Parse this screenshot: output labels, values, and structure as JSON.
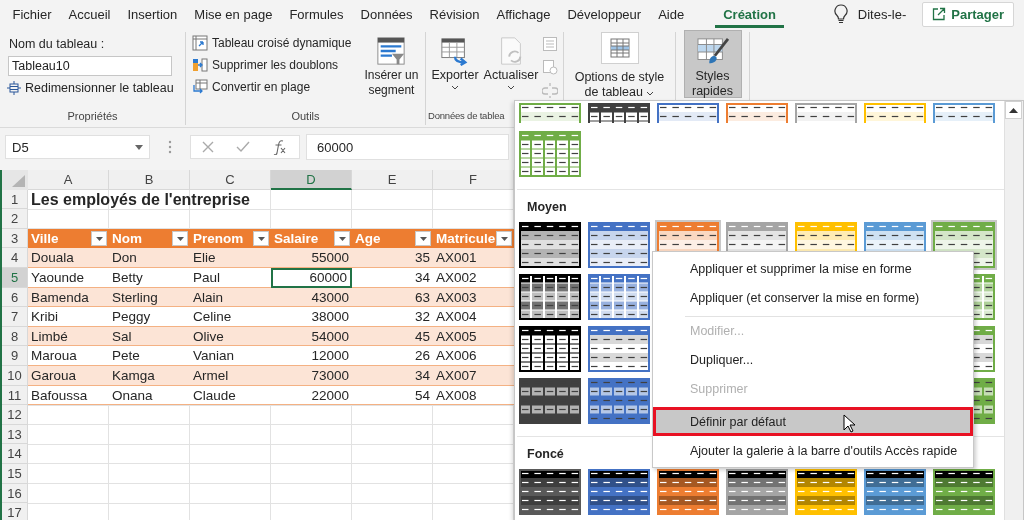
{
  "menu_tabs": [
    {
      "label": "Fichier",
      "selected": false
    },
    {
      "label": "Accueil",
      "selected": false
    },
    {
      "label": "Insertion",
      "selected": false
    },
    {
      "label": "Mise en page",
      "selected": false
    },
    {
      "label": "Formules",
      "selected": false
    },
    {
      "label": "Données",
      "selected": false
    },
    {
      "label": "Révision",
      "selected": false
    },
    {
      "label": "Affichage",
      "selected": false
    },
    {
      "label": "Développeur",
      "selected": false
    },
    {
      "label": "Aide",
      "selected": false
    },
    {
      "label": "Création",
      "selected": true
    }
  ],
  "tell_me": "Dites-le-",
  "share_button": "Partager",
  "properties_group": {
    "label": "Propriétés",
    "name_label": "Nom du tableau :",
    "name_value": "Tableau10",
    "resize_button": "Redimensionner le tableau"
  },
  "tools_group": {
    "label": "Outils",
    "commands": [
      {
        "kind": "pivot",
        "label": "Tableau croisé dynamique"
      },
      {
        "kind": "dedupe",
        "label": "Supprimer les doublons"
      },
      {
        "kind": "convert",
        "label": "Convertir en plage"
      }
    ],
    "slicer_button": "Insérer un segment"
  },
  "external_group": {
    "label": "Données de tablea",
    "buttons": [
      {
        "kind": "export",
        "label": "Exporter"
      },
      {
        "kind": "refresh",
        "label": "Actualiser"
      }
    ]
  },
  "style_options_button": "Options de style de tableau",
  "quick_styles_button": {
    "label": "Styles rapides",
    "selected": true
  },
  "formula_bar": {
    "name_box": "D5",
    "value": "60000"
  },
  "sheet": {
    "columns": [
      {
        "label": "A",
        "selected": false
      },
      {
        "label": "B",
        "selected": false
      },
      {
        "label": "C",
        "selected": false
      },
      {
        "label": "D",
        "selected": true
      },
      {
        "label": "E",
        "selected": false
      },
      {
        "label": "F",
        "selected": false
      }
    ],
    "row_numbers": [
      {
        "label": "1",
        "selected": false
      },
      {
        "label": "2",
        "selected": false
      },
      {
        "label": "3",
        "selected": false
      },
      {
        "label": "4",
        "selected": false
      },
      {
        "label": "5",
        "selected": true
      },
      {
        "label": "6",
        "selected": false
      },
      {
        "label": "7",
        "selected": false
      },
      {
        "label": "8",
        "selected": false
      },
      {
        "label": "9",
        "selected": false
      },
      {
        "label": "10",
        "selected": false
      },
      {
        "label": "11",
        "selected": false
      },
      {
        "label": "12",
        "selected": false
      },
      {
        "label": "13",
        "selected": false
      },
      {
        "label": "14",
        "selected": false
      },
      {
        "label": "15",
        "selected": false
      },
      {
        "label": "16",
        "selected": false
      },
      {
        "label": "17",
        "selected": false
      }
    ],
    "title": "Les employés de l'entreprise",
    "table": {
      "headers": [
        {
          "label": "Ville",
          "kind": "text"
        },
        {
          "label": "Nom",
          "kind": "text"
        },
        {
          "label": "Prenom",
          "kind": "text"
        },
        {
          "label": "Salaire",
          "kind": "number"
        },
        {
          "label": "Age",
          "kind": "number"
        },
        {
          "label": "Matricule",
          "kind": "text"
        }
      ],
      "rows": [
        {
          "cells": [
            {
              "text": "Douala",
              "selected": false
            },
            {
              "text": "Don",
              "selected": false
            },
            {
              "text": "Elie",
              "selected": false
            },
            {
              "text": "55000",
              "selected": false
            },
            {
              "text": "35",
              "selected": false
            },
            {
              "text": "AX001",
              "selected": false
            }
          ]
        },
        {
          "cells": [
            {
              "text": "Yaounde",
              "selected": false
            },
            {
              "text": "Betty",
              "selected": false
            },
            {
              "text": "Paul",
              "selected": false
            },
            {
              "text": "60000",
              "selected": true
            },
            {
              "text": "34",
              "selected": false
            },
            {
              "text": "AX002",
              "selected": false
            }
          ]
        },
        {
          "cells": [
            {
              "text": "Bamenda",
              "selected": false
            },
            {
              "text": "Sterling",
              "selected": false
            },
            {
              "text": "Alain",
              "selected": false
            },
            {
              "text": "43000",
              "selected": false
            },
            {
              "text": "63",
              "selected": false
            },
            {
              "text": "AX003",
              "selected": false
            }
          ]
        },
        {
          "cells": [
            {
              "text": "Kribi",
              "selected": false
            },
            {
              "text": "Peggy",
              "selected": false
            },
            {
              "text": "Celine",
              "selected": false
            },
            {
              "text": "38000",
              "selected": false
            },
            {
              "text": "32",
              "selected": false
            },
            {
              "text": "AX004",
              "selected": false
            }
          ]
        },
        {
          "cells": [
            {
              "text": "Limbé",
              "selected": false
            },
            {
              "text": "Sal",
              "selected": false
            },
            {
              "text": "Olive",
              "selected": false
            },
            {
              "text": "54000",
              "selected": false
            },
            {
              "text": "45",
              "selected": false
            },
            {
              "text": "AX005",
              "selected": false
            }
          ]
        },
        {
          "cells": [
            {
              "text": "Maroua",
              "selected": false
            },
            {
              "text": "Pete",
              "selected": false
            },
            {
              "text": "Vanian",
              "selected": false
            },
            {
              "text": "12000",
              "selected": false
            },
            {
              "text": "26",
              "selected": false
            },
            {
              "text": "AX006",
              "selected": false
            }
          ]
        },
        {
          "cells": [
            {
              "text": "Garoua",
              "selected": false
            },
            {
              "text": "Kamga",
              "selected": false
            },
            {
              "text": "Armel",
              "selected": false
            },
            {
              "text": "73000",
              "selected": false
            },
            {
              "text": "34",
              "selected": false
            },
            {
              "text": "AX007",
              "selected": false
            }
          ]
        },
        {
          "cells": [
            {
              "text": "Bafoussa",
              "selected": false
            },
            {
              "text": "Onana",
              "selected": false
            },
            {
              "text": "Claude",
              "selected": false
            },
            {
              "text": "22000",
              "selected": false
            },
            {
              "text": "54",
              "selected": false
            },
            {
              "text": "AX008",
              "selected": false
            }
          ]
        }
      ]
    }
  },
  "style_gallery": {
    "sections": [
      {
        "rows": [
          {
            "cut": true,
            "left": [
              {
                "kind": "light",
                "color": "#70ad47",
                "selected": false
              },
              {
                "kind": "grid",
                "color": "#404040",
                "selected": false
              },
              {
                "kind": "light",
                "color": "#4472c4",
                "selected": false
              },
              {
                "kind": "light",
                "color": "#ed7d31",
                "selected": false
              },
              {
                "kind": "light",
                "color": "#a5a5a5",
                "selected": false
              },
              {
                "kind": "light",
                "color": "#ffc000",
                "selected": false
              },
              {
                "kind": "light",
                "color": "#5b9bd5",
                "selected": false
              }
            ]
          },
          {
            "cut": false,
            "left": [
              {
                "kind": "grid",
                "color": "#70ad47",
                "selected": false
              }
            ]
          }
        ]
      },
      {
        "label": "Moyen",
        "rows": [
          {
            "cut": false,
            "left": [
              {
                "kind": "medium",
                "color": "#000000",
                "selected": false
              },
              {
                "kind": "medium",
                "color": "#4472c4",
                "selected": false
              },
              {
                "kind": "medium",
                "color": "#ed7d31",
                "selected": true
              },
              {
                "kind": "medium",
                "color": "#a5a5a5",
                "selected": false
              },
              {
                "kind": "medium",
                "color": "#ffc000",
                "selected": false
              },
              {
                "kind": "medium",
                "color": "#5b9bd5",
                "selected": false
              },
              {
                "kind": "medium",
                "color": "#70ad47",
                "selected": true
              }
            ]
          },
          {
            "cut": false,
            "left": [
              {
                "kind": "banded",
                "color": "#000000",
                "selected": false
              },
              {
                "kind": "banded",
                "color": "#4472c4",
                "selected": false
              }
            ],
            "right": [
              {
                "kind": "banded",
                "color": "#70ad47",
                "selected": false
              }
            ]
          },
          {
            "cut": false,
            "left": [
              {
                "kind": "grid",
                "color": "#000000",
                "selected": false
              },
              {
                "kind": "striped",
                "color": "#4472c4",
                "selected": false
              }
            ],
            "right": [
              {
                "kind": "striped",
                "color": "#70ad47",
                "selected": false
              }
            ]
          },
          {
            "cut": false,
            "left": [
              {
                "kind": "gridbanded",
                "color": "#404040",
                "selected": false
              },
              {
                "kind": "gridbanded",
                "color": "#4472c4",
                "selected": false
              }
            ],
            "right": [
              {
                "kind": "gridbanded",
                "color": "#70ad47",
                "selected": false
              }
            ]
          }
        ]
      },
      {
        "label": "Foncé",
        "rows": [
          {
            "cut": false,
            "left": [
              {
                "kind": "dark",
                "color": "#595959",
                "selected": false
              },
              {
                "kind": "dark",
                "color": "#4472c4",
                "selected": false
              },
              {
                "kind": "dark",
                "color": "#ed7d31",
                "selected": false
              },
              {
                "kind": "dark",
                "color": "#a5a5a5",
                "selected": false
              },
              {
                "kind": "dark",
                "color": "#ffc000",
                "selected": false
              },
              {
                "kind": "dark",
                "color": "#5b9bd5",
                "selected": false
              },
              {
                "kind": "dark",
                "color": "#70ad47",
                "selected": false
              }
            ]
          }
        ]
      }
    ]
  },
  "context_menu": [
    {
      "label": "Appliquer et supprimer la mise en forme",
      "disabled": false,
      "selected": false,
      "separator_before": false
    },
    {
      "label": "Appliquer (et conserver la mise en forme)",
      "disabled": false,
      "selected": false,
      "separator_before": false
    },
    {
      "label": "Modifier...",
      "disabled": true,
      "selected": false,
      "separator_before": true
    },
    {
      "label": "Dupliquer...",
      "disabled": false,
      "selected": false,
      "separator_before": false
    },
    {
      "label": "Supprimer",
      "disabled": true,
      "selected": false,
      "separator_before": false
    },
    {
      "label": "Définir par défaut",
      "disabled": false,
      "selected": true,
      "separator_before": true
    },
    {
      "label": "Ajouter la galerie à la barre d'outils Accès rapide",
      "disabled": false,
      "selected": false,
      "separator_before": false
    }
  ]
}
